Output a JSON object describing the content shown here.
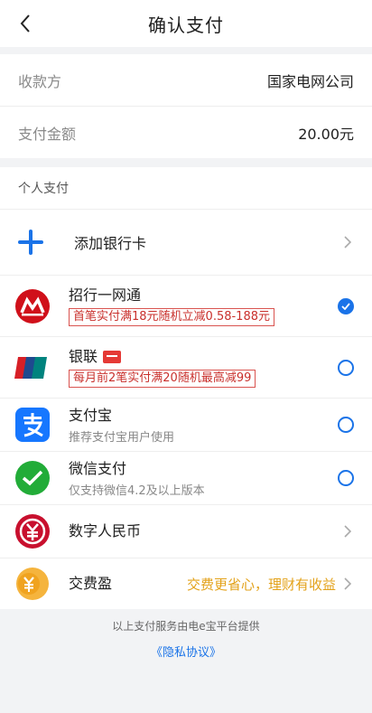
{
  "header": {
    "title": "确认支付"
  },
  "info": {
    "payee_label": "收款方",
    "payee_value": "国家电网公司",
    "amount_label": "支付金额",
    "amount_value": "20.00元"
  },
  "payment": {
    "section_title": "个人支付",
    "add_card_label": "添加银行卡",
    "methods": [
      {
        "name": "招行一网通",
        "promo": "首笔实付满18元随机立减0.58-188元",
        "selected": true
      },
      {
        "name": "银联",
        "promo": "每月前2笔实付满20随机最高减99",
        "selected": false
      },
      {
        "name": "支付宝",
        "subtitle": "推荐支付宝用户使用",
        "selected": false
      },
      {
        "name": "微信支付",
        "subtitle": "仅支持微信4.2及以上版本",
        "selected": false
      },
      {
        "name": "数字人民币"
      },
      {
        "name": "交费盈",
        "link": "交费更省心，理财有收益"
      }
    ]
  },
  "footer": {
    "note": "以上支付服务由电e宝平台提供",
    "privacy": "《隐私协议》"
  },
  "colors": {
    "accent": "#1a73e8",
    "promo": "#c9302c",
    "gold": "#e3a21a"
  }
}
